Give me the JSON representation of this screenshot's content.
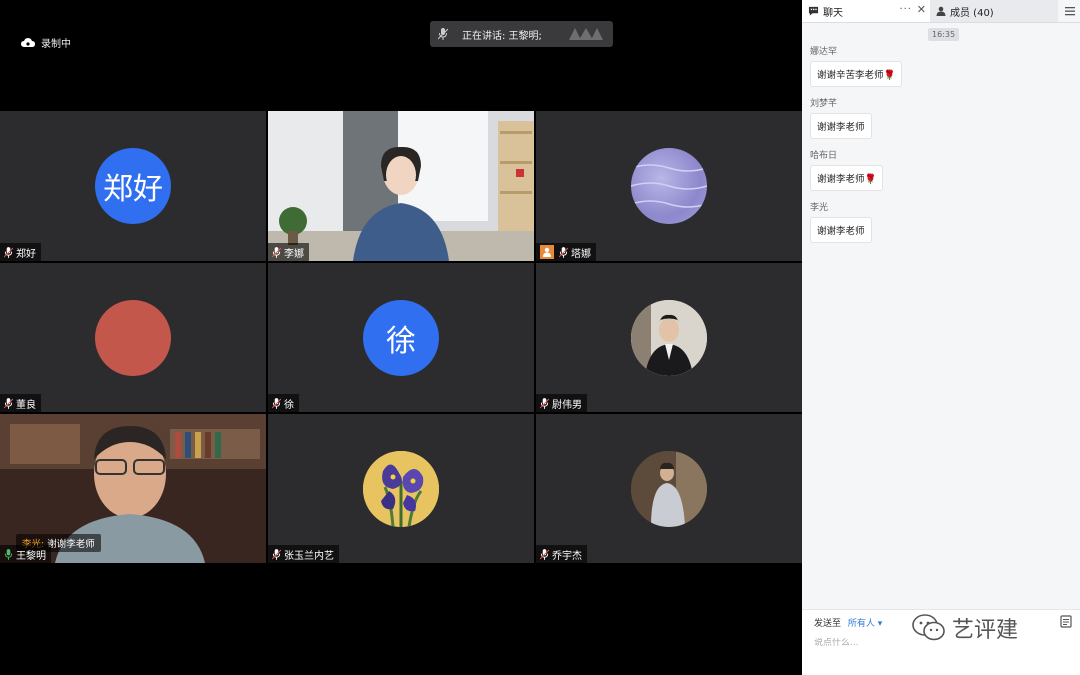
{
  "recording": {
    "label": "录制中"
  },
  "speaking": {
    "label": "正在讲话: 王黎明;"
  },
  "tiles": [
    {
      "name": "郑好",
      "avatar_text": "郑好",
      "avatar_color": "#2f6ff0"
    },
    {
      "name": "李娜"
    },
    {
      "name": "塔娜"
    },
    {
      "name": "董良",
      "avatar_color": "#c4574c"
    },
    {
      "name": "徐",
      "avatar_text": "徐",
      "avatar_color": "#2f6ff0"
    },
    {
      "name": "尉伟男"
    },
    {
      "name": "王黎明",
      "overlay_sender": "李光:",
      "overlay_message": "谢谢李老师"
    },
    {
      "name": "张玉兰内艺"
    },
    {
      "name": "乔宇杰"
    }
  ],
  "chat": {
    "tab_chat": "聊天",
    "tab_more": "···",
    "tab_close": "✕",
    "tab_members": "成员 (40)",
    "time": "16:35",
    "messages": [
      {
        "sender": "娜达罕",
        "text": "谢谢辛苦李老师",
        "rose": "🌹"
      },
      {
        "sender": "刘梦芊",
        "text": "谢谢李老师"
      },
      {
        "sender": "哈布日",
        "text": "谢谢李老师",
        "rose": "🌹"
      },
      {
        "sender": "李光",
        "text": "谢谢李老师"
      }
    ],
    "send_to_label": "发送至",
    "recipient": "所有人 ▾",
    "input_placeholder": "说点什么...",
    "watermark": "艺评建"
  },
  "colors": {
    "active_speaker": "#4dbd74",
    "tile_bg": "#2c2c2e",
    "accent_blue": "#2f7bdb"
  }
}
